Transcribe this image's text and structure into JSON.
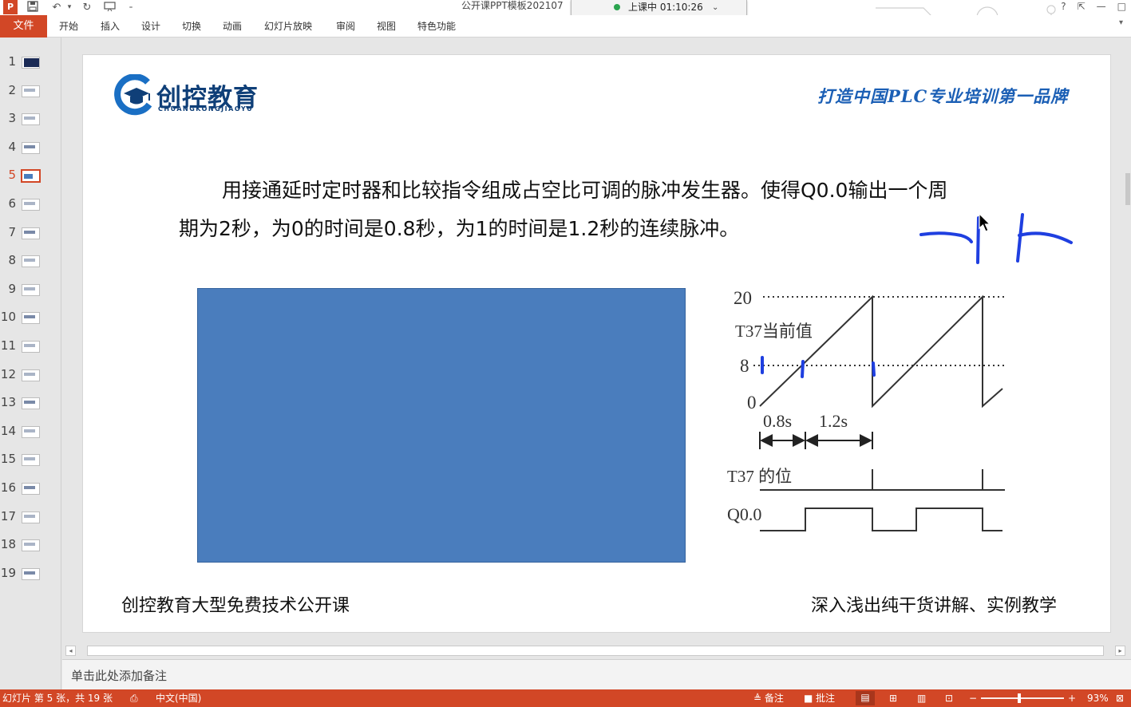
{
  "app": {
    "document_title": "公开课PPT模板202107",
    "window_controls": [
      "?",
      "⇱",
      "—",
      "□"
    ]
  },
  "meeting": {
    "status_text": "上课中 01:10:26",
    "chevron": "⌄"
  },
  "ribbon": {
    "file_tab": "文件",
    "tabs": [
      "开始",
      "插入",
      "设计",
      "切换",
      "动画",
      "幻灯片放映",
      "审阅",
      "视图",
      "特色功能"
    ]
  },
  "thumbnails": {
    "numbers": [
      "1",
      "2",
      "3",
      "4",
      "5",
      "6",
      "7",
      "8",
      "9",
      "10",
      "11",
      "12",
      "13",
      "14",
      "15",
      "16",
      "17",
      "18",
      "19"
    ],
    "active_index": 5
  },
  "slide": {
    "brand_name": "创控教育",
    "brand_pinyin": "CHUANGKONGJIAOYU",
    "slogan": "打造中国PLC专业培训第一品牌",
    "body_line_1": "用接通延时定时器和比较指令组成占空比可调的脉冲发生器。使得Q0.0输出一个周",
    "body_line_2": "期为2秒，为0的时间是0.8秒，为1的时间是1.2秒的连续脉冲。",
    "footer_left": "创控教育大型免费技术公开课",
    "footer_right": "深入浅出纯干货讲解、实例教学",
    "timing": {
      "label_20": "20",
      "label_t37_value": "T37当前值",
      "label_8": "8",
      "label_0": "0",
      "label_08s": "0.8s",
      "label_12s": "1.2s",
      "label_t37_bit": "T37 的位",
      "label_q00": "Q0.0"
    }
  },
  "notes": {
    "placeholder": "单击此处添加备注"
  },
  "status": {
    "slide_info": "幻灯片 第 5 张，共 19 张",
    "language": "中文(中国)",
    "notes_btn": "≜ 备注",
    "comments_btn": "批注",
    "zoom": "93%"
  },
  "colors": {
    "accent": "#d24726",
    "slide_rect": "#4a7dbd",
    "brand_blue": "#0f3f78",
    "slogan_blue": "#1b5fb5",
    "ink_blue": "#1f3fe0"
  }
}
